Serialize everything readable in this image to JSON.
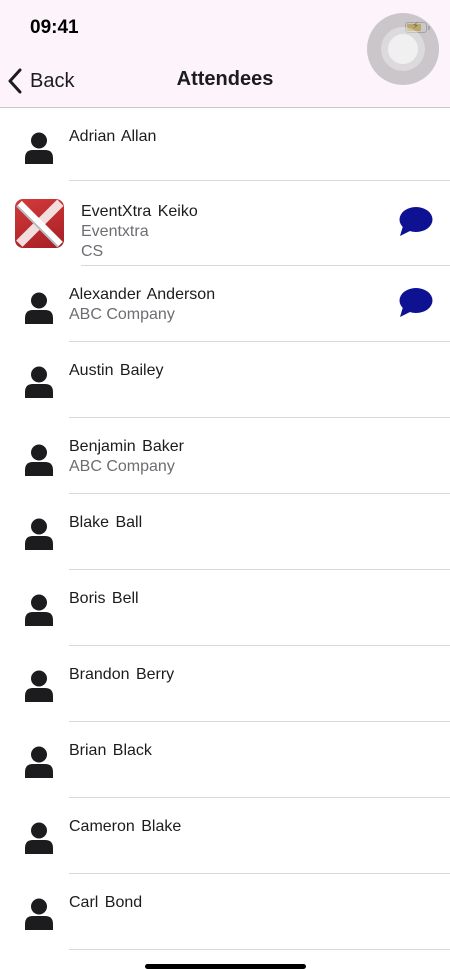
{
  "status_bar": {
    "time": "09:41"
  },
  "nav": {
    "back_label": "Back",
    "title": "Attendees"
  },
  "colors": {
    "chat_bubble": "#0d1192",
    "battery_fill": "#e0b020",
    "topbar_bg": "#fcf4fa"
  },
  "attendees": [
    {
      "name": "Adrian  Allan",
      "lines": [],
      "icon": "person-icon",
      "chat": false
    },
    {
      "name": "EventXtra Keiko",
      "lines": [
        "Eventxtra",
        "CS"
      ],
      "icon": "eventxtra-logo-icon",
      "chat": true
    },
    {
      "name": "Alexander  Anderson",
      "lines": [
        "ABC Company"
      ],
      "icon": "person-icon",
      "chat": true
    },
    {
      "name": "Austin Bailey",
      "lines": [],
      "icon": "person-icon",
      "chat": false
    },
    {
      "name": "Benjamin  Baker",
      "lines": [
        "ABC Company"
      ],
      "icon": "person-icon",
      "chat": false
    },
    {
      "name": "Blake Ball",
      "lines": [],
      "icon": "person-icon",
      "chat": false
    },
    {
      "name": "Boris  Bell",
      "lines": [],
      "icon": "person-icon",
      "chat": false
    },
    {
      "name": "Brandon  Berry",
      "lines": [],
      "icon": "person-icon",
      "chat": false
    },
    {
      "name": "Brian  Black",
      "lines": [],
      "icon": "person-icon",
      "chat": false
    },
    {
      "name": "Cameron Blake",
      "lines": [],
      "icon": "person-icon",
      "chat": false
    },
    {
      "name": "Carl  Bond",
      "lines": [],
      "icon": "person-icon",
      "chat": false
    }
  ]
}
